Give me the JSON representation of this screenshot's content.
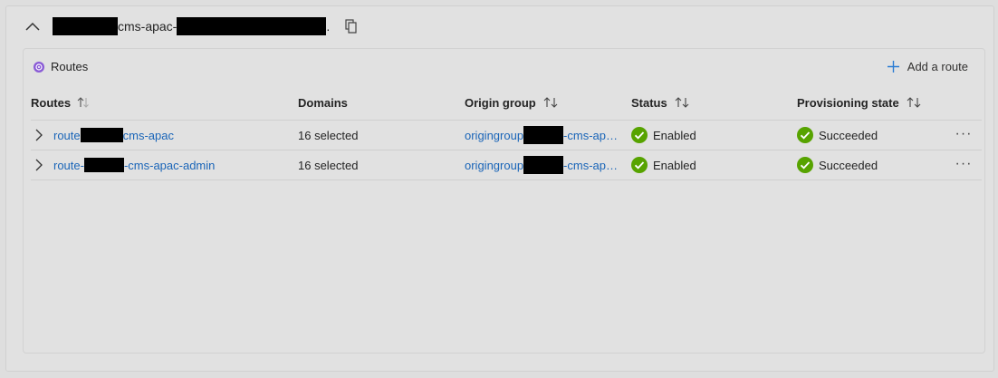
{
  "endpoint": {
    "name_middle": "cms-apac-",
    "name_end": "."
  },
  "routes_card": {
    "title": "Routes",
    "add_label": "Add a route"
  },
  "table": {
    "columns": {
      "routes": "Routes",
      "domains": "Domains",
      "origin_group": "Origin group",
      "status": "Status",
      "provisioning_state": "Provisioning state"
    },
    "rows": [
      {
        "route_prefix": "route",
        "route_suffix": "cms-apac",
        "domains": "16 selected",
        "origin_prefix": "origingroup",
        "origin_suffix": "-cms-ap…",
        "status": "Enabled",
        "provisioning": "Succeeded",
        "more": "···"
      },
      {
        "route_prefix": "route-",
        "route_suffix": "-cms-apac-admin",
        "domains": "16 selected",
        "origin_prefix": "origingroup",
        "origin_suffix": "-cms-ap…",
        "status": "Enabled",
        "provisioning": "Succeeded",
        "more": "···"
      }
    ]
  },
  "colors": {
    "link": "#1a65b8",
    "success": "#57a300",
    "routes_icon": "#8a5bd6",
    "add_icon": "#2b7cd3"
  },
  "icons": {
    "collapse": "chevron-up-icon",
    "copy": "copy-icon",
    "routes": "routes-icon",
    "add": "plus-icon",
    "expand": "chevron-right-icon",
    "status": "check-circle-icon",
    "more": "more-icon"
  }
}
